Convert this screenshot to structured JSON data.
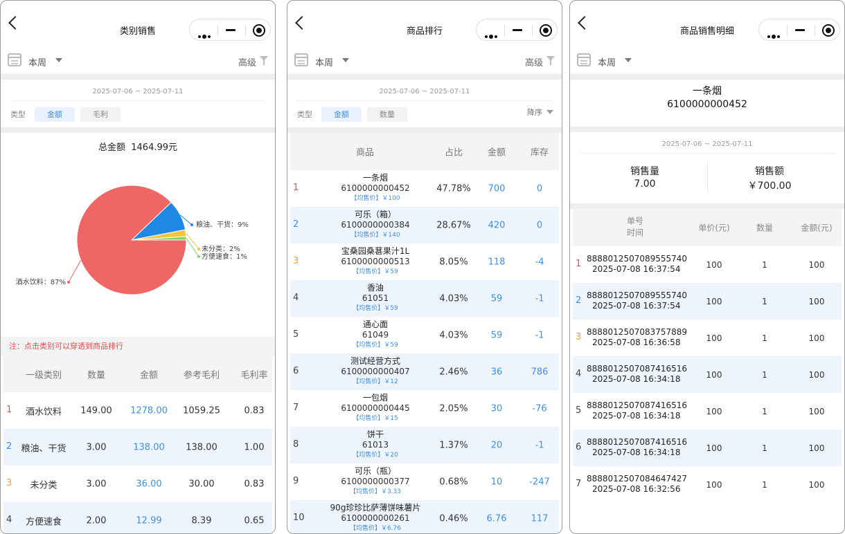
{
  "capsule": {
    "menu_icon": "more-dots-icon",
    "minimize_icon": "minus-icon",
    "close_icon": "target-icon"
  },
  "panel1": {
    "title": "类别销售",
    "filter": {
      "period": "本周",
      "advanced": "高级"
    },
    "date_range": "2025-07-06 ~ 2025-07-11",
    "type_label": "类型",
    "tabs": [
      "金额",
      "毛利"
    ],
    "total_label": "总金额",
    "total_value": "1464.99元",
    "note": "注：点击类别可以穿透到商品排行",
    "table_headers": [
      "一级类别",
      "数量",
      "金额",
      "参考毛利",
      "毛利率"
    ],
    "rows": [
      {
        "rank": "1",
        "category": "酒水饮料",
        "qty": "149.00",
        "amount": "1278.00",
        "profit": "1059.25",
        "rate": "0.83"
      },
      {
        "rank": "2",
        "category": "粮油、干货",
        "qty": "3.00",
        "amount": "138.00",
        "profit": "138.00",
        "rate": "1.00"
      },
      {
        "rank": "3",
        "category": "未分类",
        "qty": "3.00",
        "amount": "36.00",
        "profit": "30.00",
        "rate": "0.83"
      },
      {
        "rank": "4",
        "category": "方便速食",
        "qty": "2.00",
        "amount": "12.99",
        "profit": "8.39",
        "rate": "0.65"
      }
    ]
  },
  "chart_data": {
    "type": "pie",
    "slices": [
      {
        "label": "酒水饮料：87%",
        "value": 87,
        "color": "#ee6666"
      },
      {
        "label": "粮油、干货：9%",
        "value": 9,
        "color": "#1e88e5"
      },
      {
        "label": "未分类：2%",
        "value": 2,
        "color": "#f6c343"
      },
      {
        "label": "方便速食：1%",
        "value": 1,
        "color": "#7ed36b"
      }
    ]
  },
  "panel2": {
    "title": "商品排行",
    "filter": {
      "period": "本周",
      "advanced": "高级"
    },
    "date_range": "2025-07-06 ~ 2025-07-11",
    "type_label": "类型",
    "tabs": [
      "金额",
      "数量"
    ],
    "sort": "降序",
    "table_headers": [
      "商品",
      "占比",
      "金额",
      "库存"
    ],
    "rows": [
      {
        "rank": "1",
        "name": "一条烟",
        "code": "6100000000452",
        "avg": "【均售价】￥100",
        "share": "47.78%",
        "amount": "700",
        "stock": "0"
      },
      {
        "rank": "2",
        "name": "可乐（箱）",
        "code": "6100000000384",
        "avg": "【均售价】￥140",
        "share": "28.67%",
        "amount": "420",
        "stock": "0"
      },
      {
        "rank": "3",
        "name": "宝桑园桑葚果汁1L",
        "code": "6100000000513",
        "avg": "【均售价】￥59",
        "share": "8.05%",
        "amount": "118",
        "stock": "-4"
      },
      {
        "rank": "4",
        "name": "香油",
        "code": "61051",
        "avg": "【均售价】￥59",
        "share": "4.03%",
        "amount": "59",
        "stock": "-1"
      },
      {
        "rank": "5",
        "name": "通心面",
        "code": "61049",
        "avg": "【均售价】￥59",
        "share": "4.03%",
        "amount": "59",
        "stock": "-1"
      },
      {
        "rank": "6",
        "name": "测试经营方式",
        "code": "6100000000407",
        "avg": "【均售价】￥12",
        "share": "2.46%",
        "amount": "36",
        "stock": "786"
      },
      {
        "rank": "7",
        "name": "一包烟",
        "code": "6100000000445",
        "avg": "【均售价】￥15",
        "share": "2.05%",
        "amount": "30",
        "stock": "-76"
      },
      {
        "rank": "8",
        "name": "饼干",
        "code": "61013",
        "avg": "【均售价】￥20",
        "share": "1.37%",
        "amount": "20",
        "stock": "-1"
      },
      {
        "rank": "9",
        "name": "可乐（瓶）",
        "code": "6100000000377",
        "avg": "【均售价】￥3.33",
        "share": "0.68%",
        "amount": "10",
        "stock": "-247"
      },
      {
        "rank": "10",
        "name": "90g珍珍比萨薄饼味薯片",
        "code": "6100000000261",
        "avg": "【均售价】￥6.76",
        "share": "0.46%",
        "amount": "6.76",
        "stock": "117"
      }
    ]
  },
  "panel3": {
    "title": "商品销售明细",
    "filter": {
      "period": "本周"
    },
    "item_name": "一条烟",
    "item_code": "6100000000452",
    "date_range": "2025-07-06 ~ 2025-07-11",
    "kpi": {
      "qty_label": "销售量",
      "qty_value": "7.00",
      "amount_label": "销售额",
      "amount_value": "￥700.00"
    },
    "table_headers": {
      "order": "单号",
      "time": "时间",
      "price": "单价(元)",
      "qty": "数量",
      "amount": "金额(元)"
    },
    "rows": [
      {
        "rank": "1",
        "order": "8888012507089555740",
        "time": "2025-07-08 16:37:54",
        "price": "100",
        "qty": "1",
        "amount": "100"
      },
      {
        "rank": "2",
        "order": "8888012507089555740",
        "time": "2025-07-08 16:37:54",
        "price": "100",
        "qty": "1",
        "amount": "100"
      },
      {
        "rank": "3",
        "order": "8888012507083757889",
        "time": "2025-07-08 16:36:58",
        "price": "100",
        "qty": "1",
        "amount": "100"
      },
      {
        "rank": "4",
        "order": "8888012507087416516",
        "time": "2025-07-08 16:34:18",
        "price": "100",
        "qty": "1",
        "amount": "100"
      },
      {
        "rank": "5",
        "order": "8888012507087416516",
        "time": "2025-07-08 16:34:18",
        "price": "100",
        "qty": "1",
        "amount": "100"
      },
      {
        "rank": "6",
        "order": "8888012507087416516",
        "time": "2025-07-08 16:34:18",
        "price": "100",
        "qty": "1",
        "amount": "100"
      },
      {
        "rank": "7",
        "order": "8888012507084647427",
        "time": "2025-07-08 16:32:56",
        "price": "100",
        "qty": "1",
        "amount": "100"
      }
    ]
  }
}
